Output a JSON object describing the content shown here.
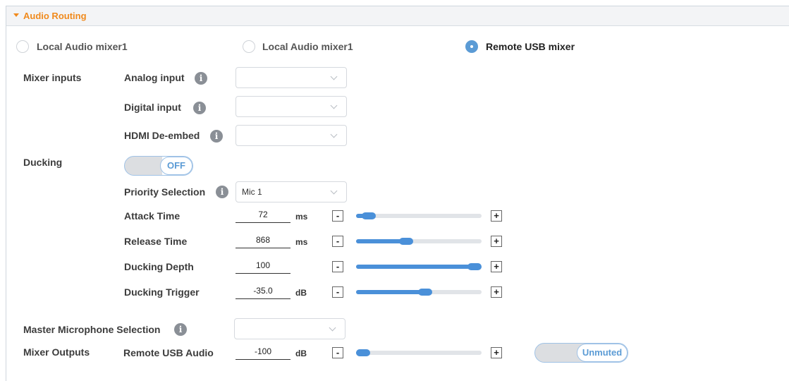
{
  "panel": {
    "title": "Audio Routing"
  },
  "routing_options": [
    {
      "label": "Local Audio mixer1",
      "selected": false
    },
    {
      "label": "Local Audio mixer1",
      "selected": false
    },
    {
      "label": "Remote USB mixer",
      "selected": true
    }
  ],
  "mixer_inputs": {
    "label": "Mixer inputs",
    "rows": [
      {
        "label": "Analog input",
        "value": ""
      },
      {
        "label": "Digital input",
        "value": ""
      },
      {
        "label": "HDMI De-embed",
        "value": ""
      }
    ]
  },
  "ducking": {
    "label": "Ducking",
    "toggle_label": "OFF",
    "priority": {
      "label": "Priority Selection",
      "value": "Mic 1"
    },
    "params": [
      {
        "label": "Attack Time",
        "value": "72",
        "unit": "ms",
        "level": 0.1
      },
      {
        "label": "Release Time",
        "value": "868",
        "unit": "ms",
        "level": 0.4
      },
      {
        "label": "Ducking Depth",
        "value": "100",
        "unit": "",
        "level": 1.0
      },
      {
        "label": "Ducking Trigger",
        "value": "-35.0",
        "unit": "dB",
        "level": 0.55
      }
    ]
  },
  "master_mic": {
    "label": "Master Microphone Selection",
    "value": ""
  },
  "mixer_outputs": {
    "label": "Mixer Outputs",
    "row": {
      "label": "Remote USB Audio",
      "value": "-100",
      "unit": "dB",
      "level": 0.0
    },
    "mute_label": "Unmuted"
  },
  "icons": {
    "info": "info-icon",
    "caret": "caret-down-icon",
    "chevron": "chevron-down-icon"
  },
  "colors": {
    "accent": "#4a90d9",
    "header_text": "#f08a1d"
  },
  "stepper": {
    "minus": "-",
    "plus": "+"
  }
}
